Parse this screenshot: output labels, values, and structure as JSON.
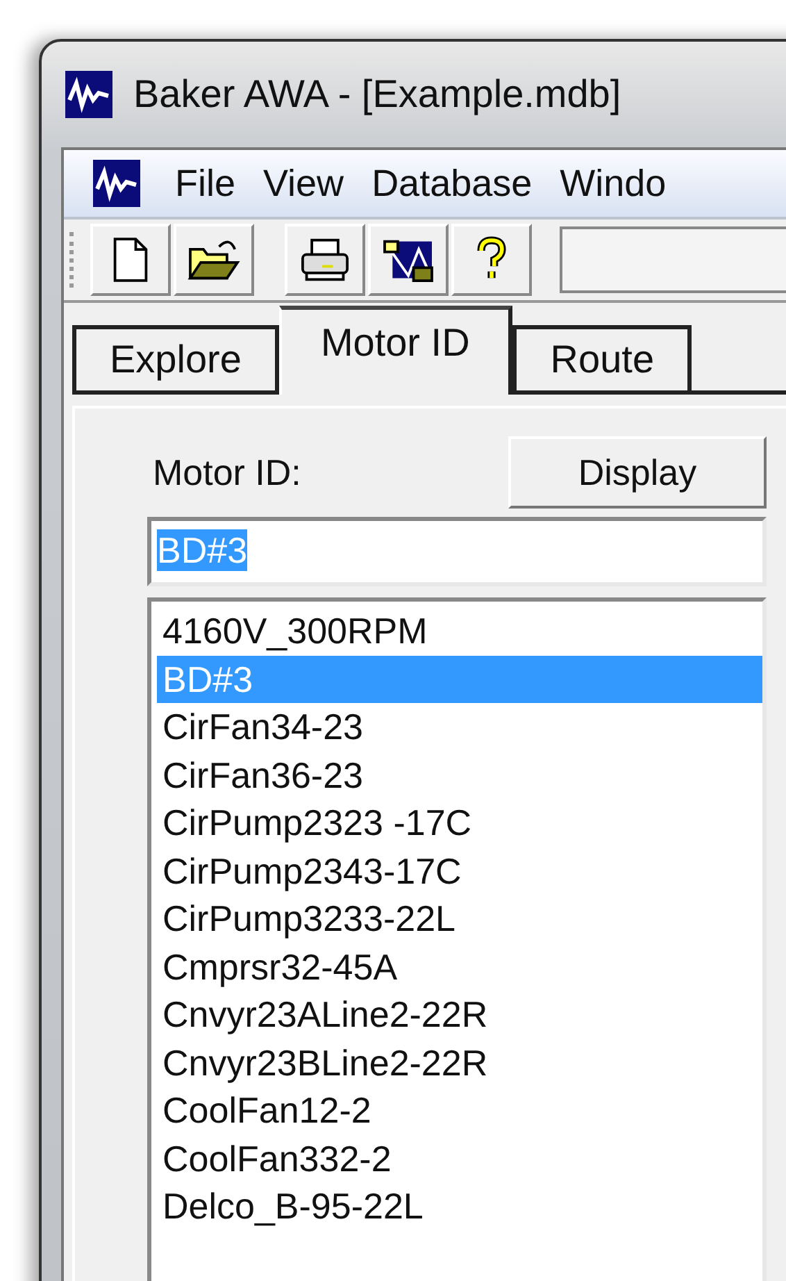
{
  "window": {
    "title": "Baker AWA - [Example.mdb]"
  },
  "menu_bar": {
    "items": [
      "File",
      "View",
      "Database",
      "Windo"
    ]
  },
  "tabs": [
    {
      "label": "Explore",
      "selected": false
    },
    {
      "label": "Motor ID",
      "selected": true
    },
    {
      "label": "Route",
      "selected": false
    }
  ],
  "motor_id": {
    "label": "Motor ID:",
    "button": "Display",
    "field": {
      "value": "BD#3",
      "value_selected": true
    }
  },
  "motor_list": [
    {
      "name": "4160V_300RPM",
      "selected": false
    },
    {
      "name": "BD#3",
      "selected": true
    },
    {
      "name": "CirFan34-23",
      "selected": false
    },
    {
      "name": "CirFan36-23",
      "selected": false
    },
    {
      "name": "CirPump2323 -17C",
      "selected": false
    },
    {
      "name": "CirPump2343-17C",
      "selected": false
    },
    {
      "name": "CirPump3233-22L",
      "selected": false
    },
    {
      "name": "Cmprsr32-45A",
      "selected": false
    },
    {
      "name": "Cnvyr23ALine2-22R",
      "selected": false
    },
    {
      "name": "Cnvyr23BLine2-22R",
      "selected": false
    },
    {
      "name": "CoolFan12-2",
      "selected": false
    },
    {
      "name": "CoolFan332-2",
      "selected": false
    },
    {
      "name": "Delco_B-95-22L",
      "selected": false
    }
  ]
}
